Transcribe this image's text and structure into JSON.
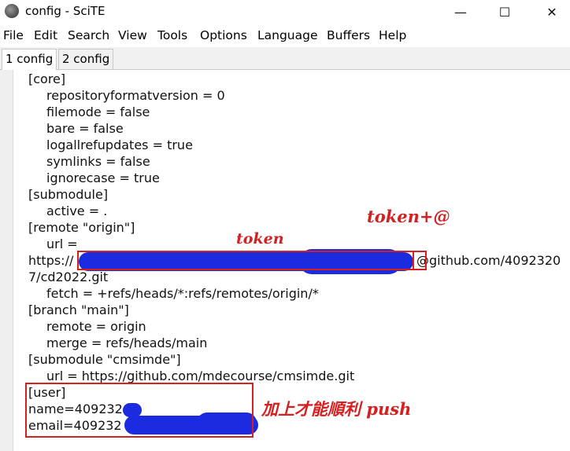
{
  "window": {
    "title": "config - SciTE",
    "minimize_glyph": "—",
    "maximize_glyph": "☐",
    "close_glyph": "✕"
  },
  "menu": [
    "File",
    "Edit",
    "Search",
    "View",
    "Tools",
    "Options",
    "Language",
    "Buffers",
    "Help"
  ],
  "tabs": [
    {
      "label": "1 config",
      "active": true
    },
    {
      "label": "2 config",
      "active": false
    }
  ],
  "editor_lines": {
    "l1": "[core]",
    "l2": "repositoryformatversion = 0",
    "l3": "filemode = false",
    "l4": "bare = false",
    "l5": "logallrefupdates = true",
    "l6": "symlinks = false",
    "l7": "ignorecase = true",
    "l8": "[submodule]",
    "l9": "active = .",
    "l10": "[remote \"origin\"]",
    "l11": "url =",
    "l12a": "https://",
    "l12b": "@github.com/4092320",
    "l13": "7/cd2022.git",
    "l14": "fetch = +refs/heads/*:refs/remotes/origin/*",
    "l15": "[branch \"main\"]",
    "l16": "remote = origin",
    "l17": "merge = refs/heads/main",
    "l18": "[submodule \"cmsimde\"]",
    "l19": "url = https://github.com/mdecourse/cmsimde.git",
    "l20": "[user]",
    "l21": "name=409232",
    "l22": "email=409232"
  },
  "annotations": {
    "token": "token",
    "token_at": "token+@",
    "push_note": "加上才能順利 push"
  },
  "colors": {
    "annotation": "#d42020",
    "scribble": "#1a2be0"
  }
}
